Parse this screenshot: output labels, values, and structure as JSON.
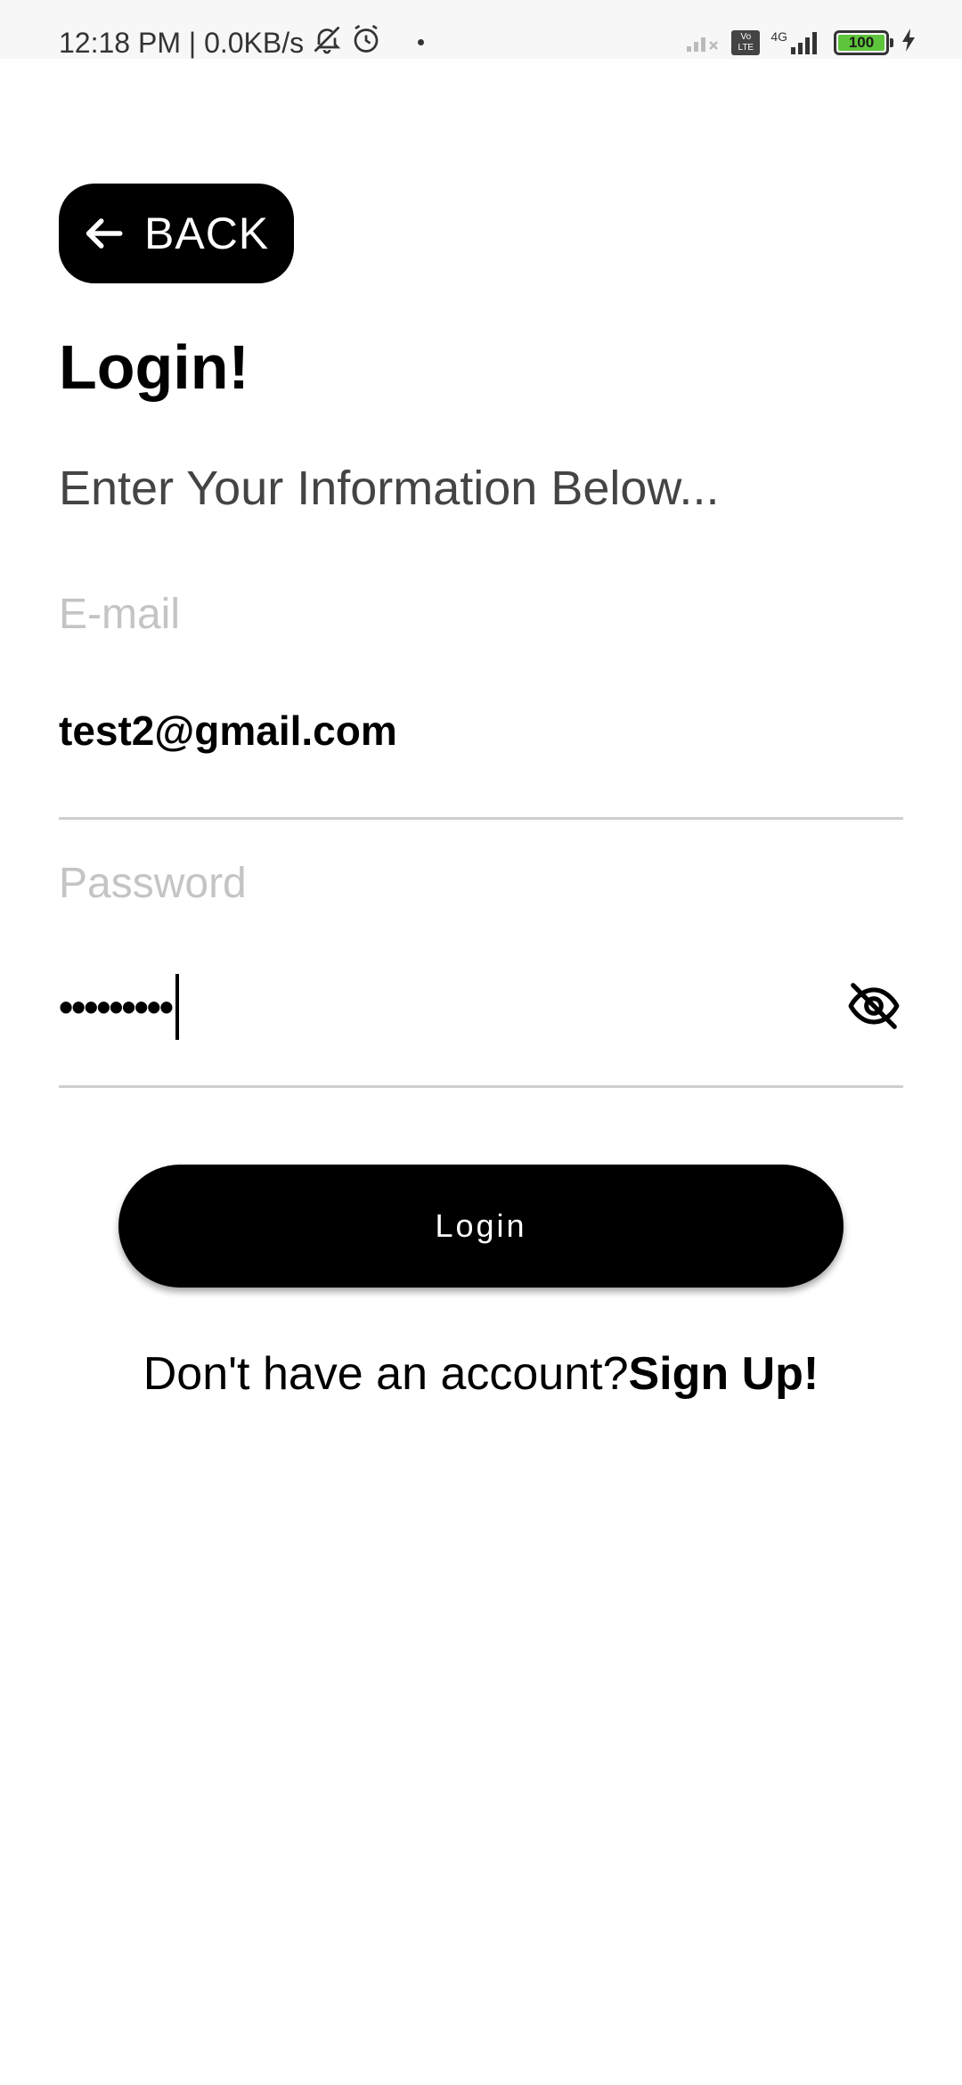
{
  "status_bar": {
    "time": "12:18 PM",
    "separator": " | ",
    "network_speed": "0.0KB/s",
    "icons": [
      "notifications-off-icon",
      "alarm-icon",
      "signal-no-sim-icon",
      "volte-icon",
      "4g-signal-icon",
      "battery-icon",
      "charging-icon"
    ],
    "volte_text": "Vo LTE",
    "network_type": "4G",
    "battery_level": "100"
  },
  "back_button": {
    "label": "BACK",
    "icon": "arrow-left-icon"
  },
  "title": "Login!",
  "subtitle": "Enter Your Information Below...",
  "email": {
    "label": "E-mail",
    "value": "test2@gmail.com"
  },
  "password": {
    "label": "Password",
    "masked_value": "•••••••••",
    "toggle_icon": "eye-off-icon"
  },
  "login_button": {
    "label": "Login"
  },
  "signup": {
    "prompt": "Don't have an account?",
    "link": "Sign Up!"
  },
  "colors": {
    "primary": "#000000",
    "background": "#ffffff",
    "label": "#c4c4c4",
    "subtitle": "#444444",
    "divider": "#cfcfcf",
    "battery": "#5ec43b"
  }
}
